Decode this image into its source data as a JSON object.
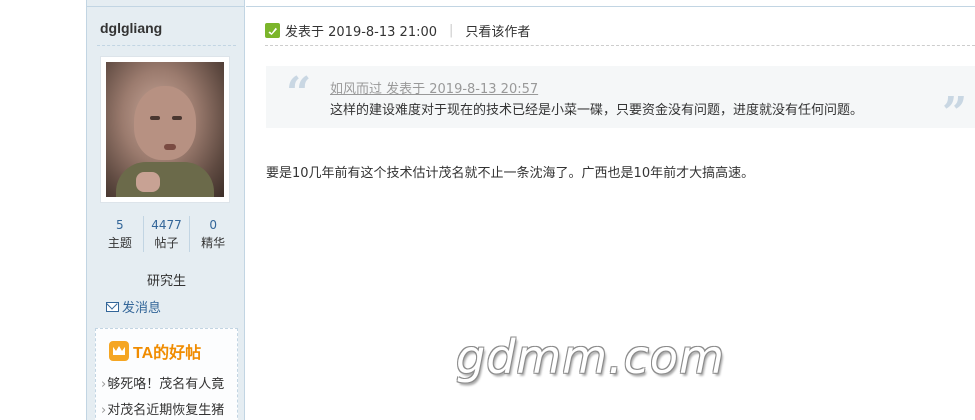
{
  "author": {
    "username": "dglgliang",
    "stats": [
      {
        "value": "5",
        "label": "主题"
      },
      {
        "value": "4477",
        "label": "帖子"
      },
      {
        "value": "0",
        "label": "精华"
      }
    ],
    "rank": "研究生",
    "send_message": "发消息",
    "good_posts": {
      "title": "TA的好帖",
      "items": [
        "够死咯！茂名有人竟",
        "对茂名近期恢复生猪"
      ]
    }
  },
  "post": {
    "posted_label": "发表于 2019-8-13 21:00",
    "separator": "|",
    "only_author": "只看该作者",
    "quote": {
      "header": "如风而过 发表于 2019-8-13 20:57",
      "text": "这样的建设难度对于现在的技术已经是小菜一碟，只要资金没有问题，进度就没有任何问题。"
    },
    "body": "要是10几年前有这个技术估计茂名就不止一条沈海了。广西也是10年前才大搞高速。"
  },
  "watermark": "gdmm.com",
  "icons": {
    "online": "online-status-icon",
    "mail": "mail-icon",
    "crown": "crown-icon"
  },
  "colors": {
    "sidebar_bg": "#e5edf2",
    "link_blue": "#336699",
    "accent_orange": "#f08c00",
    "online_green": "#7bb52b"
  }
}
